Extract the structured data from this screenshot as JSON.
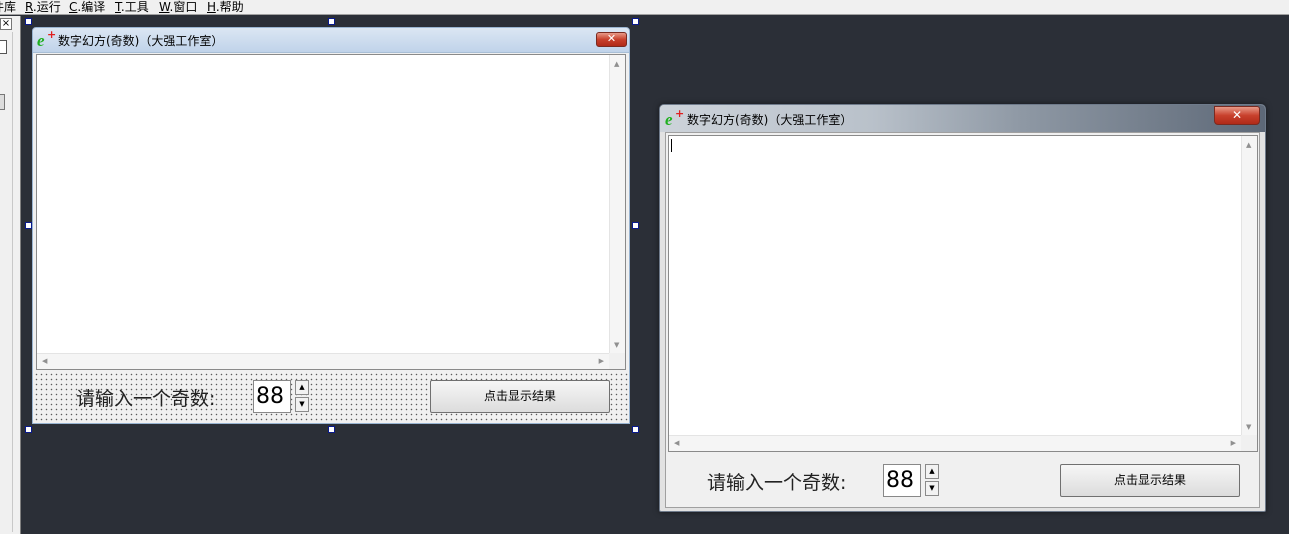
{
  "menu": {
    "items": [
      {
        "accel": "",
        "label": "组件库"
      },
      {
        "accel": "R",
        "label": ".运行"
      },
      {
        "accel": "C",
        "label": ".编译"
      },
      {
        "accel": "T",
        "label": ".工具"
      },
      {
        "accel": "W",
        "label": ".窗口"
      },
      {
        "accel": "H",
        "label": ".帮助"
      }
    ]
  },
  "left_panel": {
    "close_glyph": "×"
  },
  "design_window": {
    "title": "数字幻方(奇数)（大强工作室）",
    "prompt_label": "请输入一个奇数:",
    "input_value": "88",
    "button_label": "点击显示结果"
  },
  "runtime_window": {
    "title": "数字幻方(奇数)（大强工作室）",
    "prompt_label": "请输入一个奇数:",
    "input_value": "88",
    "button_label": "点击显示结果"
  },
  "icons": {
    "app": "e-plus-app-icon",
    "close": "close-x-icon",
    "spin_up": "spin-up-arrow-icon",
    "spin_down": "spin-down-arrow-icon"
  },
  "colors": {
    "desktop": "#2b2f37",
    "close_button": "#c8402c",
    "selection_handle": "#0a1a8c"
  }
}
